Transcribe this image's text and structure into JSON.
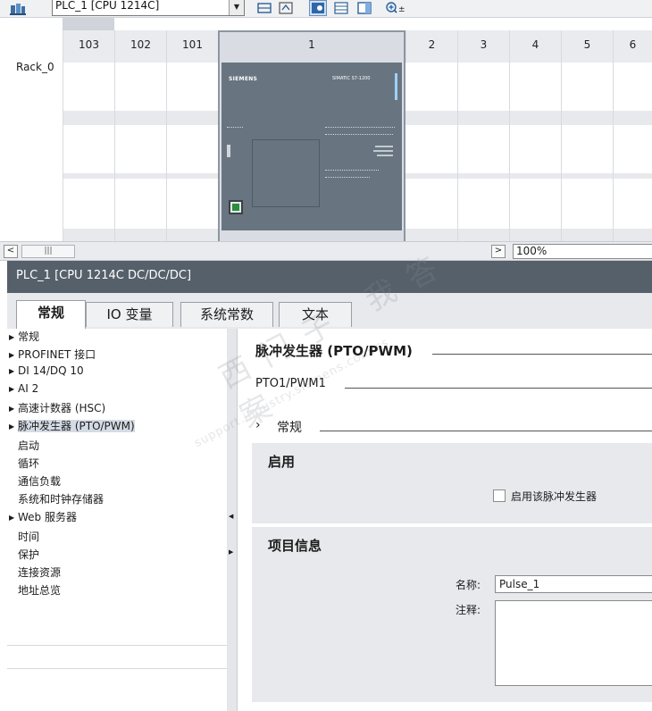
{
  "toolbar": {
    "device_select": "PLC_1 [CPU 1214C]",
    "icons": [
      "device-view-icon",
      "dropdown-arrow-icon",
      "network-icon",
      "topology-icon",
      "show-image-icon",
      "table-icon",
      "split-view-icon",
      "zoom-icon"
    ]
  },
  "rack": {
    "label": "Rack_0",
    "slots": [
      "103",
      "102",
      "101",
      "1",
      "2",
      "3",
      "4",
      "5",
      "6"
    ],
    "cpu": {
      "brand": "SIEMENS",
      "model": "SIMATIC S7-1200"
    }
  },
  "scrollbar": {
    "zoom": "100%"
  },
  "inspector": {
    "title": "PLC_1 [CPU 1214C DC/DC/DC]",
    "tabs": [
      "常规",
      "IO 变量",
      "系统常数",
      "文本"
    ],
    "nav": [
      {
        "label": "常规",
        "expandable": true
      },
      {
        "label": "PROFINET 接口",
        "expandable": true
      },
      {
        "label": "DI 14/DQ 10",
        "expandable": true
      },
      {
        "label": "AI 2",
        "expandable": true
      },
      {
        "label": "高速计数器 (HSC)",
        "expandable": true
      },
      {
        "label": "脉冲发生器 (PTO/PWM)",
        "expandable": true,
        "selected": true
      },
      {
        "label": "启动",
        "expandable": false
      },
      {
        "label": "循环",
        "expandable": false
      },
      {
        "label": "通信负载",
        "expandable": false
      },
      {
        "label": "系统和时钟存储器",
        "expandable": false
      },
      {
        "label": "Web 服务器",
        "expandable": true
      },
      {
        "label": "时间",
        "expandable": false
      },
      {
        "label": "保护",
        "expandable": false
      },
      {
        "label": "连接资源",
        "expandable": false
      },
      {
        "label": "地址总览",
        "expandable": false
      }
    ],
    "content": {
      "heading": "脉冲发生器 (PTO/PWM)",
      "subheading": "PTO1/PWM1",
      "section": "常规",
      "enable_panel": {
        "title": "启用",
        "checkbox_label": "启用该脉冲发生器",
        "checked": false
      },
      "project_panel": {
        "title": "项目信息",
        "name_label": "名称:",
        "name_value": "Pulse_1",
        "comment_label": "注释:",
        "comment_value": ""
      }
    }
  },
  "watermark": {
    "line1": "西门子 我答案",
    "line2": "support.industry.siemens.com/cs"
  }
}
